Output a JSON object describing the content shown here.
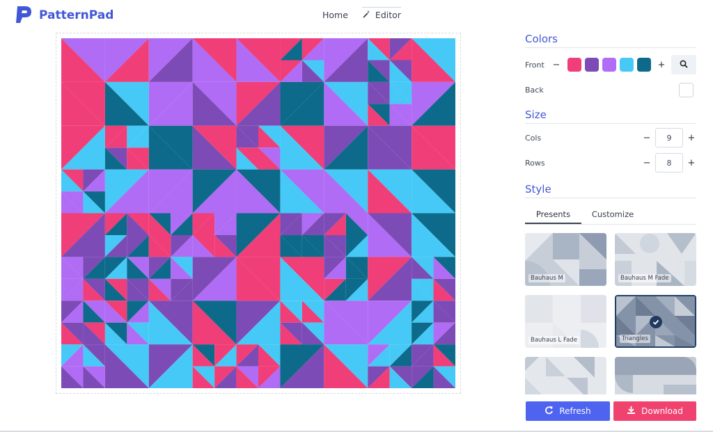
{
  "app": {
    "name": "PatternPad"
  },
  "nav": {
    "home": "Home",
    "editor": "Editor"
  },
  "colors": {
    "title": "Colors",
    "front_label": "Front",
    "back_label": "Back",
    "front_swatches": [
      "#f03e78",
      "#7d4bb5",
      "#b06cf4",
      "#46c9f6",
      "#0e6a8a"
    ],
    "back_color": "#ffffff",
    "minus": "−",
    "plus": "+"
  },
  "size": {
    "title": "Size",
    "cols_label": "Cols",
    "cols_value": "9",
    "rows_label": "Rows",
    "rows_value": "8",
    "minus": "−",
    "plus": "+"
  },
  "style": {
    "title": "Style",
    "tabs": [
      "Presents",
      "Customize"
    ],
    "active_tab": "Presents",
    "presets": [
      {
        "label": "Bauhaus M",
        "selected": false
      },
      {
        "label": "Bauhaus M Fade",
        "selected": false
      },
      {
        "label": "Bauhaus L Fade",
        "selected": false
      },
      {
        "label": "Triangles",
        "selected": true
      },
      {
        "label": "",
        "selected": false
      },
      {
        "label": "",
        "selected": false
      }
    ]
  },
  "actions": {
    "refresh": "Refresh",
    "download": "Download"
  },
  "theme": {
    "accent": "#4257d6",
    "refresh_color": "#4e63f0",
    "download_color": "#f0426f"
  }
}
